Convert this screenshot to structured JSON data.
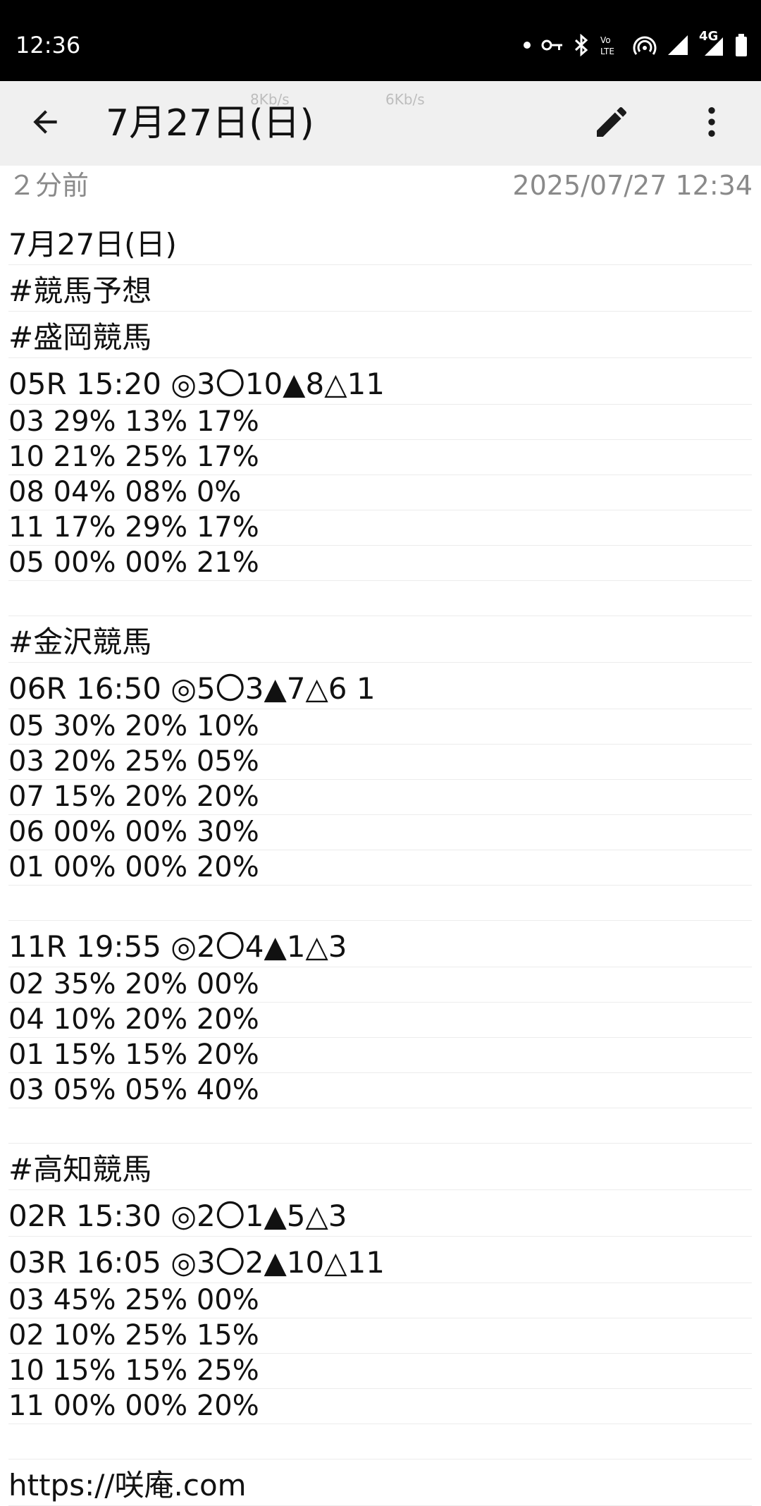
{
  "status_bar": {
    "time": "12:36",
    "network_label": "4G",
    "icons": [
      "notification-dot-icon",
      "vpn-key-icon",
      "bluetooth-icon",
      "volte-icon",
      "hotspot-icon",
      "signal-icon",
      "battery-icon"
    ]
  },
  "app_bar": {
    "title": "7月27日(日)",
    "net_speed_1": "8Kb/s",
    "net_speed_2": "6Kb/s",
    "icons": [
      "back-arrow-icon",
      "pencil-icon",
      "more-vert-icon"
    ]
  },
  "meta": {
    "relative_time": "２分前",
    "timestamp": "2025/07/27 12:34"
  },
  "note_lines": [
    "7月27日(日)",
    "#競馬予想",
    "#盛岡競馬",
    "05R 15:20 ◎3〇10▲8△11",
    "03 29% 13% 17%",
    "10 21% 25% 17%",
    "08 04% 08% 0%",
    "11 17% 29% 17%",
    "05 00% 00% 21%",
    "",
    "#金沢競馬",
    "06R 16:50 ◎5〇3▲7△6 1",
    "05 30% 20% 10%",
    "03 20% 25% 05%",
    "07 15% 20% 20%",
    "06 00% 00% 30%",
    "01 00% 00% 20%",
    "",
    "11R 19:55 ◎2〇4▲1△3",
    "02 35% 20% 00%",
    "04 10% 20% 20%",
    "01 15% 15% 20%",
    "03 05% 05% 40%",
    "",
    "#高知競馬",
    "02R 15:30 ◎2〇1▲5△3",
    "03R 16:05 ◎3〇2▲10△11",
    "03 45% 25% 00%",
    "02 10% 25% 15%",
    "10 15% 15% 25%",
    "11 00% 00% 20%",
    "",
    "https://咲庵.com"
  ]
}
